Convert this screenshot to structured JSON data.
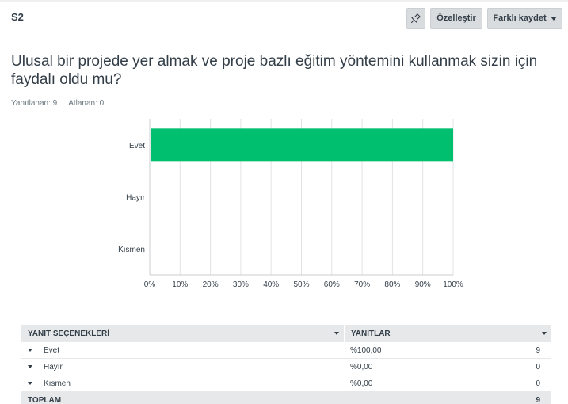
{
  "header": {
    "question_id": "S2",
    "customize_label": "Özelleştir",
    "save_as_label": "Farklı kaydet"
  },
  "question": {
    "text": " Ulusal bir projede yer almak ve proje bazlı eğitim yöntemini kullanmak sizin için faydalı oldu mu?",
    "answered": "Yanıtlanan: 9",
    "skipped": "Atlanan: 0"
  },
  "colors": {
    "bar": "#00bf6f",
    "grid": "#e0e3e6",
    "axis": "#cbced2"
  },
  "chart_data": {
    "type": "bar",
    "orientation": "horizontal",
    "categories": [
      "Evet",
      "Hayır",
      "Kısmen"
    ],
    "values": [
      100,
      0,
      0
    ],
    "xlim": [
      0,
      100
    ],
    "xticks": [
      "0%",
      "10%",
      "20%",
      "30%",
      "40%",
      "50%",
      "60%",
      "70%",
      "80%",
      "90%",
      "100%"
    ],
    "grid": true
  },
  "table": {
    "col_choice": "YANIT SEÇENEKLERİ",
    "col_responses": "YANITLAR",
    "rows": [
      {
        "label": "Evet",
        "percent": "%100,00",
        "count": "9"
      },
      {
        "label": "Hayır",
        "percent": "%0,00",
        "count": "0"
      },
      {
        "label": "Kısmen",
        "percent": "%0,00",
        "count": "0"
      }
    ],
    "total_label": "TOPLAM",
    "total_count": "9"
  }
}
